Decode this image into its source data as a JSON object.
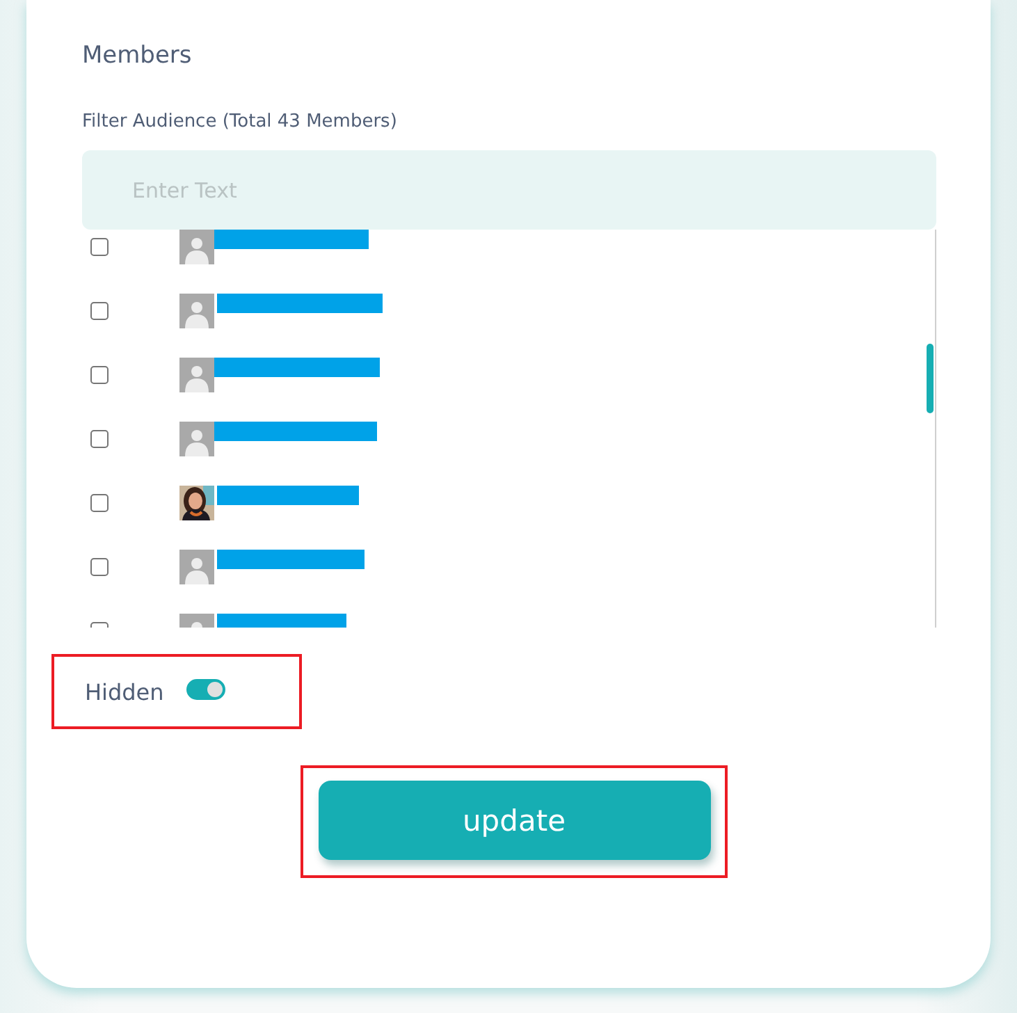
{
  "section_title": "Members",
  "filter": {
    "label": "Filter Audience (Total 43 Members)",
    "placeholder": "Enter Text"
  },
  "members": [
    {
      "checked": false,
      "avatar": {
        "kind": "silhouette"
      }
    },
    {
      "checked": false,
      "avatar": {
        "kind": "silhouette"
      }
    },
    {
      "checked": false,
      "avatar": {
        "kind": "silhouette"
      }
    },
    {
      "checked": false,
      "avatar": {
        "kind": "silhouette"
      }
    },
    {
      "checked": false
    },
    {
      "checked": false,
      "avatar": {
        "kind": "silhouette"
      }
    },
    {
      "checked": false,
      "avatar": {
        "kind": "silhouette"
      }
    }
  ],
  "hidden": {
    "label": "Hidden",
    "on": true,
    "highlighted": true
  },
  "update_button": {
    "label": "update",
    "highlighted": true
  }
}
